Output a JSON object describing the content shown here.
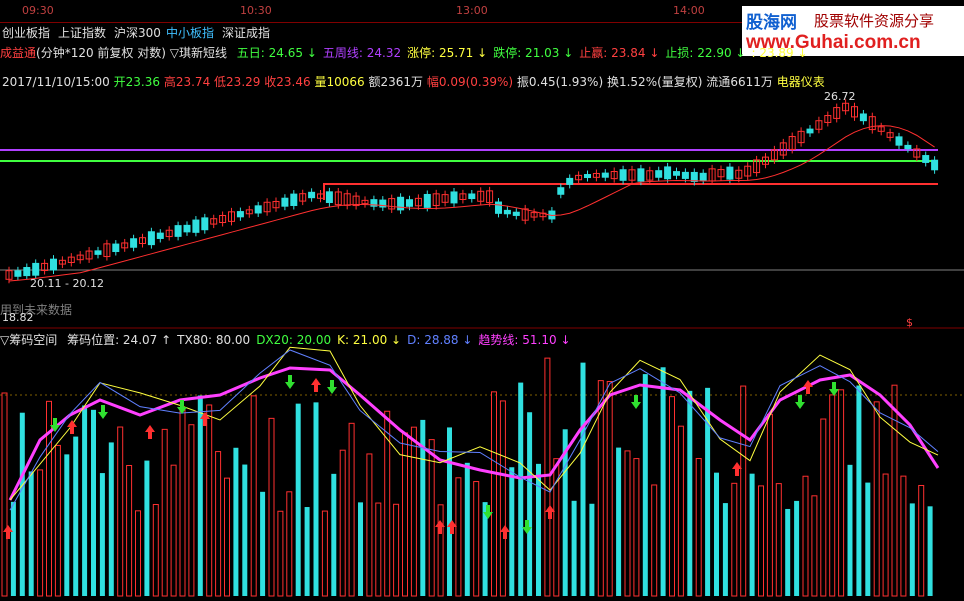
{
  "time_ticks": [
    "09:30",
    "10:30",
    "13:00",
    "14:00"
  ],
  "tabs": [
    {
      "label": "创业板指"
    },
    {
      "label": "上证指数"
    },
    {
      "label": "沪深300"
    },
    {
      "label": "中小板指"
    },
    {
      "label": "深证成指"
    }
  ],
  "logo": {
    "name": "股海网",
    "slogan": "股票软件资源分享",
    "url": "www.Guhai.com.cn"
  },
  "indicator_row": {
    "name": "成益通",
    "params": "(分钟*120 前复权 对数) ▽琪新短线",
    "items": [
      {
        "label": "五日:",
        "value": "24.65",
        "arrow": "↓",
        "color": "#40ff40"
      },
      {
        "label": "五周线:",
        "value": "24.32",
        "arrow": "",
        "color": "#b040ff"
      },
      {
        "label": "涨停:",
        "value": "25.71",
        "arrow": "↓",
        "color": "#ffff40"
      },
      {
        "label": "跌停:",
        "value": "21.03",
        "arrow": "↓",
        "color": "#40ff40"
      },
      {
        "label": "止赢:",
        "value": "23.84",
        "arrow": "↓",
        "color": "#ff4040"
      },
      {
        "label": "止损:",
        "value": "22.90",
        "arrow": "↓",
        "color": "#40ff40"
      },
      {
        "label": ":",
        "value": "23.89",
        "arrow": "↓",
        "color": "#ffff40"
      }
    ]
  },
  "quote_row": {
    "datetime": "2017/11/10/15:00",
    "open_label": "开",
    "open": "23.36",
    "high_label": "高",
    "high": "23.74",
    "low_label": "低",
    "low": "23.29",
    "close_label": "收",
    "close": "23.46",
    "vol_label": "量",
    "vol": "10066",
    "amt_label": "额",
    "amt": "2361万",
    "chg_label": "幅",
    "chg": "0.09(0.39%)",
    "amp_label": "振",
    "amp": "0.45(1.93%)",
    "turn_label": "换",
    "turn": "1.52%(量复权)",
    "float_label": "流通",
    "float": "6611万",
    "sector": "电器仪表"
  },
  "price_annotations": {
    "high_mark": "26.72",
    "range": "20.11 - 20.12",
    "future_note": "用到未来数据",
    "low_mark": "18.82"
  },
  "lower_panel": {
    "title": "▽筹码空间",
    "items": [
      {
        "label": "筹码位置:",
        "value": "24.07",
        "arrow": "↑",
        "color": "#e0e0e0"
      },
      {
        "label": "TX80:",
        "value": "80.00",
        "arrow": "",
        "color": "#e0e0e0"
      },
      {
        "label": "DX20:",
        "value": "20.00",
        "arrow": "",
        "color": "#40ff40"
      },
      {
        "label": "K:",
        "value": "21.00",
        "arrow": "↓",
        "color": "#ffff40"
      },
      {
        "label": "D:",
        "value": "28.88",
        "arrow": "↓",
        "color": "#6080ff"
      },
      {
        "label": "趋势线:",
        "value": "51.10",
        "arrow": "↓",
        "color": "#ff40ff"
      }
    ]
  },
  "colors": {
    "up": "#ff3030",
    "down": "#30e0e0",
    "ma_short": "#40ff40",
    "week": "#b040ff",
    "trend": "#ff40ff",
    "k": "#ffff40",
    "d": "#6080ff"
  }
}
